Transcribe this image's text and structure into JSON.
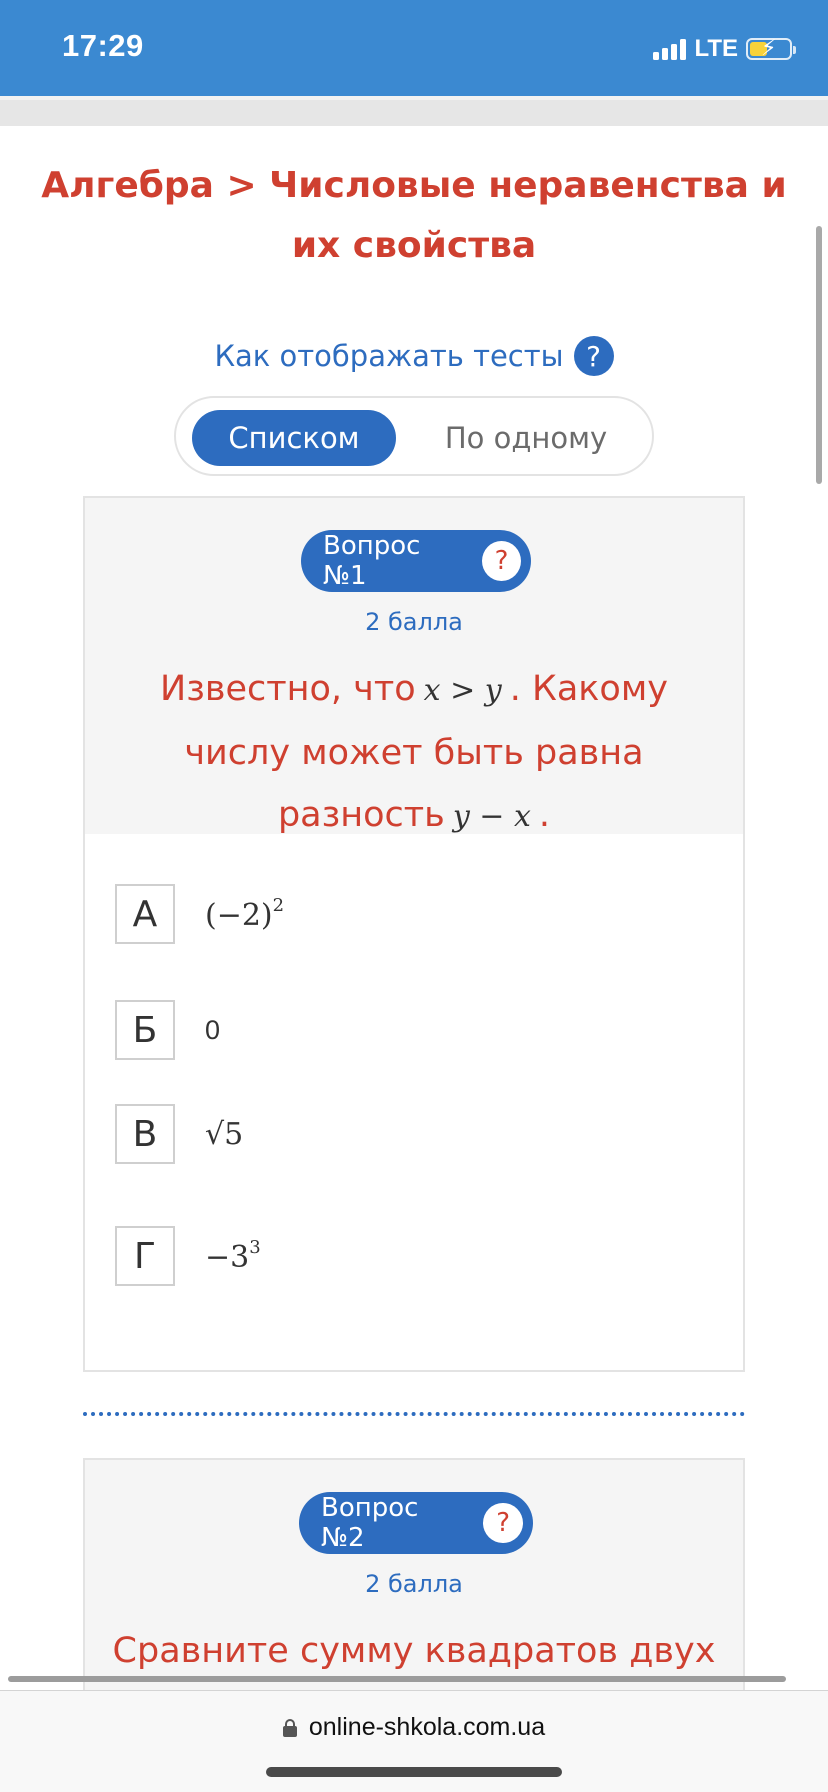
{
  "status_bar": {
    "time": "17:29",
    "network": "LTE",
    "accent_color": "#3b89d1"
  },
  "page": {
    "title": "Алгебра > Числовые неравенства и их свойства",
    "view_label": "Как отображать тесты",
    "view_help": "?",
    "toggle": {
      "active": "Списком",
      "inactive": "По одному"
    }
  },
  "questions": [
    {
      "label": "Вопрос №1",
      "help": "?",
      "points": "2 балла",
      "text_prefix": "Известно, что",
      "math_1": "x > y",
      "text_middle": ". Какому числу может быть равна разность",
      "math_2": "y − x",
      "text_suffix": ".",
      "options": [
        {
          "letter": "А",
          "base": "(−2)",
          "exp": "2"
        },
        {
          "letter": "Б",
          "base": "0",
          "exp": ""
        },
        {
          "letter": "В",
          "base": "√5",
          "exp": ""
        },
        {
          "letter": "Г",
          "base": "−3",
          "exp": "3"
        }
      ]
    },
    {
      "label": "Вопрос №2",
      "help": "?",
      "points": "2 балла",
      "text": "Сравните сумму квадратов двух"
    }
  ],
  "browser": {
    "url": "online-shkola.com.ua",
    "icon": "lock-icon"
  },
  "colors": {
    "title_red": "#cf4030",
    "primary_blue": "#2d6cbf"
  }
}
